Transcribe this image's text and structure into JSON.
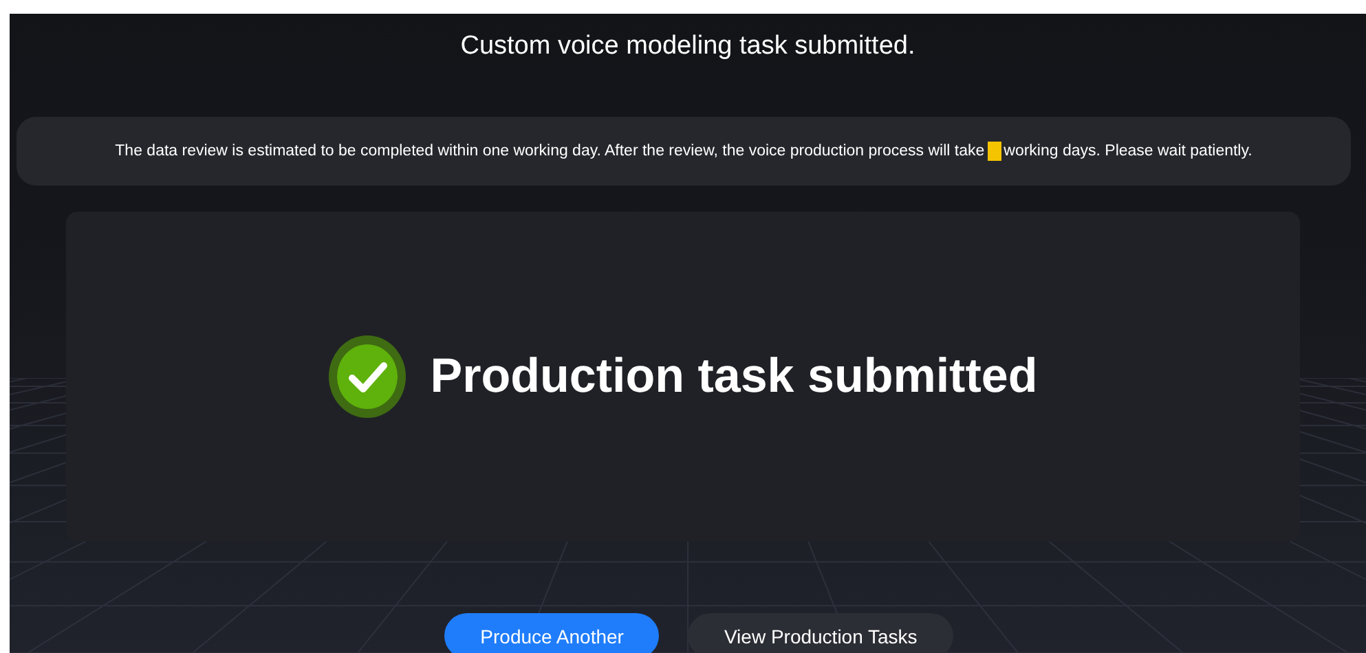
{
  "title": "Custom voice modeling task submitted.",
  "notice": {
    "before": "The data review is estimated to be completed within one working day. After the review, the voice production process will take",
    "redacted": true,
    "after": "working days. Please wait patiently."
  },
  "status": {
    "kind": "success",
    "heading": "Production task submitted"
  },
  "buttons": [
    {
      "label": "Produce Another",
      "kind": "primary"
    },
    {
      "label": "View Production Tasks",
      "kind": "secondary"
    }
  ]
}
